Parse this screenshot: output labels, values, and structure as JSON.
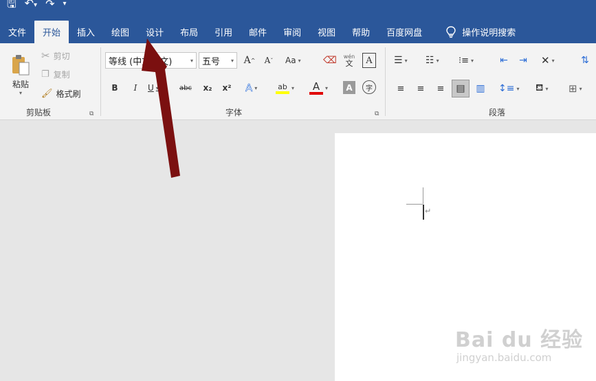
{
  "qat": {
    "save_icon": "save-icon",
    "undo_icon": "undo-icon",
    "redo_icon": "redo-icon",
    "customize_icon": "customize-icon"
  },
  "tabs": [
    {
      "label": "文件"
    },
    {
      "label": "开始"
    },
    {
      "label": "插入"
    },
    {
      "label": "绘图"
    },
    {
      "label": "设计"
    },
    {
      "label": "布局"
    },
    {
      "label": "引用"
    },
    {
      "label": "邮件"
    },
    {
      "label": "审阅"
    },
    {
      "label": "视图"
    },
    {
      "label": "帮助"
    },
    {
      "label": "百度网盘"
    }
  ],
  "tell_me": "操作说明搜索",
  "clipboard": {
    "paste": "粘贴",
    "cut": "剪切",
    "copy": "复制",
    "format_painter": "格式刷",
    "label": "剪贴板"
  },
  "font": {
    "font_name": "等线 (中文正文)",
    "font_size": "五号",
    "grow": "A",
    "shrink": "A",
    "case": "Aa",
    "phonetic": "文",
    "border": "A",
    "bold": "B",
    "italic": "I",
    "underline": "U",
    "strike": "abc",
    "subscript": "x₂",
    "superscript": "x²",
    "effects": "A",
    "highlight": "ab",
    "color": "A",
    "shading": "A",
    "enclose": "字",
    "label": "字体"
  },
  "paragraph": {
    "label": "段落"
  },
  "watermark": {
    "main": "Bai du 经验",
    "sub": "jingyan.baidu.com"
  },
  "colors": {
    "accent": "#2b579a",
    "arrow": "#7b1010",
    "highlight": "#ffff00",
    "font_color": "#e00000"
  }
}
